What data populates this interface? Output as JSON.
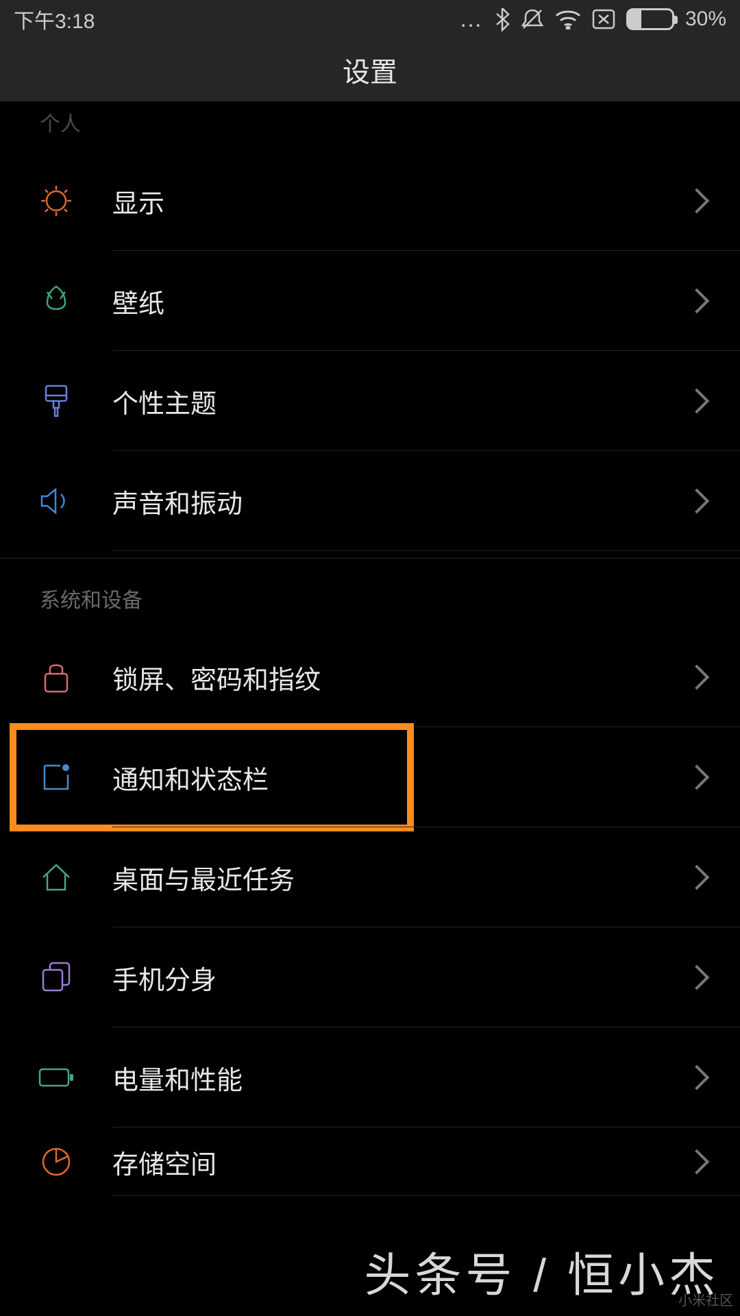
{
  "status": {
    "time": "下午3:18",
    "battery_pct": "30%"
  },
  "header": {
    "title": "设置"
  },
  "section_personal": {
    "label": "个人",
    "items": [
      {
        "label": "显示",
        "icon": "sun",
        "color": "#e06a2a"
      },
      {
        "label": "壁纸",
        "icon": "tulip",
        "color": "#3aa576"
      },
      {
        "label": "个性主题",
        "icon": "brush",
        "color": "#6d7fd9"
      },
      {
        "label": "声音和振动",
        "icon": "speaker",
        "color": "#3a8ad6"
      }
    ]
  },
  "section_system": {
    "label": "系统和设备",
    "items": [
      {
        "label": "锁屏、密码和指纹",
        "icon": "lock",
        "color": "#d66a7a",
        "highlight": false
      },
      {
        "label": "通知和状态栏",
        "icon": "notify",
        "color": "#4a8ac8",
        "highlight": true
      },
      {
        "label": "桌面与最近任务",
        "icon": "home",
        "color": "#4aa581",
        "highlight": false
      },
      {
        "label": "手机分身",
        "icon": "clone",
        "color": "#9b7dd1",
        "highlight": false
      },
      {
        "label": "电量和性能",
        "icon": "battery",
        "color": "#4aa581",
        "highlight": false
      },
      {
        "label": "存储空间",
        "icon": "pie",
        "color": "#e06a2a",
        "highlight": false
      }
    ]
  },
  "watermark": {
    "main": "头条号 / 恒小杰",
    "small": "小米社区"
  }
}
